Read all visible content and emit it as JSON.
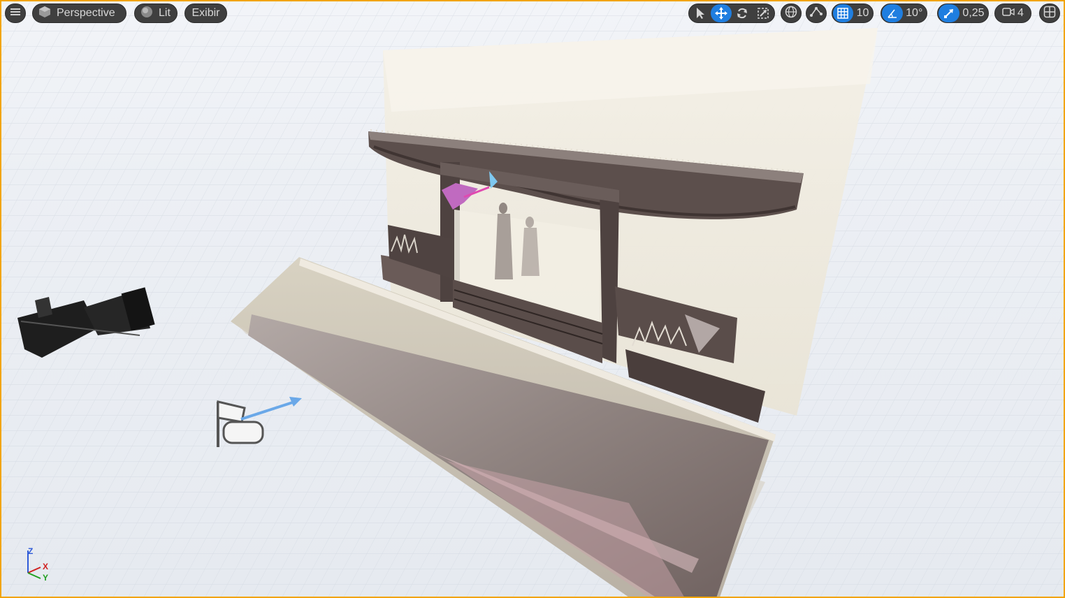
{
  "toolbar": {
    "menu_icon": "hamburger-icon",
    "view_mode": "Perspective",
    "view_mode_icon": "cube-icon",
    "lighting_mode": "Lit",
    "lighting_icon": "sphere-icon",
    "show_menu": "Exibir",
    "transform_tools": [
      "select-arrow-icon",
      "move-icon",
      "rotate-icon",
      "scale-icon"
    ],
    "world_local_icon": "globe-icon",
    "surface_snap_icon": "surface-snap-icon",
    "grid_snap_value": "10",
    "rotation_snap_value": "10°",
    "scale_snap_value": "0,25",
    "camera_speed_value": "4",
    "layout_icon": "viewport-layout-icon"
  },
  "axis_gizmo": {
    "z": "Z",
    "x": "X",
    "y": "Y"
  },
  "colors": {
    "accent": "#1f7ee0",
    "toolbar_bg": "#3f3f3f",
    "viewport_border": "#f2a400"
  }
}
